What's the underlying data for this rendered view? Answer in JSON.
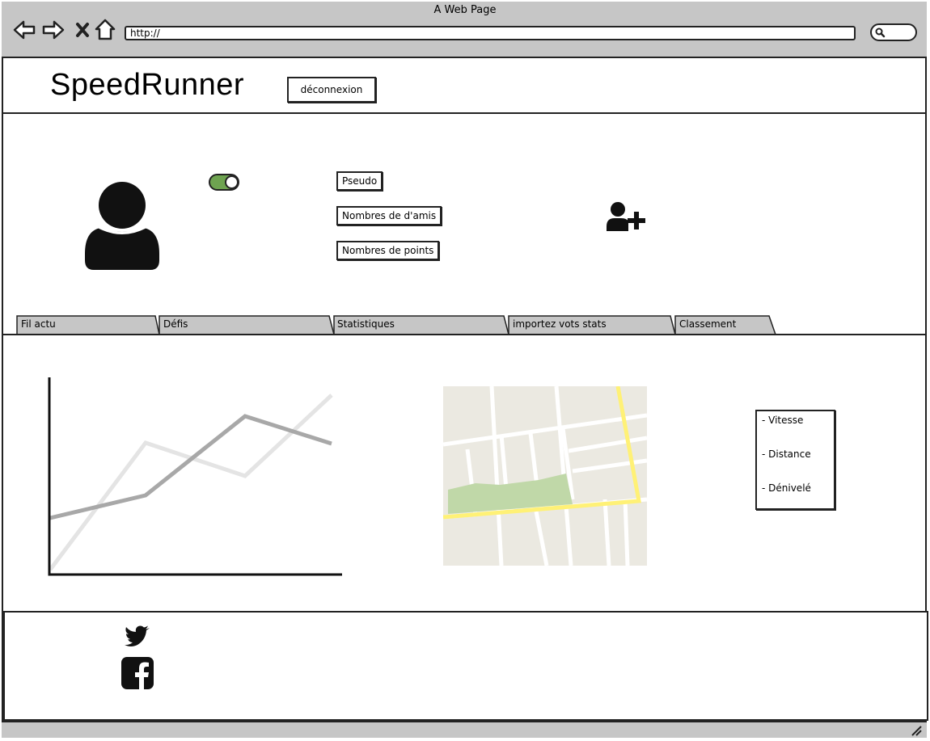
{
  "window": {
    "title": "A Web Page",
    "url": "http://"
  },
  "header": {
    "logo": "SpeedRunner",
    "logout_label": "déconnexion"
  },
  "profile": {
    "fields": [
      "Pseudo",
      "Nombres de d'amis",
      "Nombres de points"
    ],
    "status_toggle_on": true
  },
  "tabs": [
    {
      "label": "Fil actu"
    },
    {
      "label": "Défis"
    },
    {
      "label": "Statistiques"
    },
    {
      "label": "importez vots stats"
    },
    {
      "label": "Classement"
    }
  ],
  "stats_list": [
    "- Vitesse",
    "- Distance",
    "- Dénivelé"
  ],
  "colors": {
    "toggle_green": "#6ea350",
    "map_route_yellow": "#fff176",
    "map_park_green": "#c0d8a8",
    "map_ground": "#ebe9e1",
    "chrome_gray": "#c6c6c6"
  },
  "footer": {
    "icons": [
      "twitter-icon",
      "facebook-icon"
    ]
  }
}
